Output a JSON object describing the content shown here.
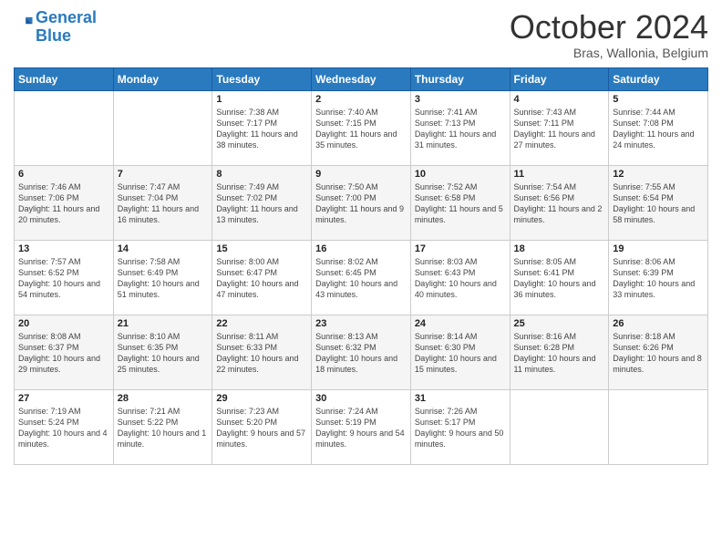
{
  "logo": {
    "line1": "General",
    "line2": "Blue"
  },
  "title": "October 2024",
  "subtitle": "Bras, Wallonia, Belgium",
  "days_of_week": [
    "Sunday",
    "Monday",
    "Tuesday",
    "Wednesday",
    "Thursday",
    "Friday",
    "Saturday"
  ],
  "weeks": [
    [
      {
        "day": "",
        "info": ""
      },
      {
        "day": "",
        "info": ""
      },
      {
        "day": "1",
        "info": "Sunrise: 7:38 AM\nSunset: 7:17 PM\nDaylight: 11 hours and 38 minutes."
      },
      {
        "day": "2",
        "info": "Sunrise: 7:40 AM\nSunset: 7:15 PM\nDaylight: 11 hours and 35 minutes."
      },
      {
        "day": "3",
        "info": "Sunrise: 7:41 AM\nSunset: 7:13 PM\nDaylight: 11 hours and 31 minutes."
      },
      {
        "day": "4",
        "info": "Sunrise: 7:43 AM\nSunset: 7:11 PM\nDaylight: 11 hours and 27 minutes."
      },
      {
        "day": "5",
        "info": "Sunrise: 7:44 AM\nSunset: 7:08 PM\nDaylight: 11 hours and 24 minutes."
      }
    ],
    [
      {
        "day": "6",
        "info": "Sunrise: 7:46 AM\nSunset: 7:06 PM\nDaylight: 11 hours and 20 minutes."
      },
      {
        "day": "7",
        "info": "Sunrise: 7:47 AM\nSunset: 7:04 PM\nDaylight: 11 hours and 16 minutes."
      },
      {
        "day": "8",
        "info": "Sunrise: 7:49 AM\nSunset: 7:02 PM\nDaylight: 11 hours and 13 minutes."
      },
      {
        "day": "9",
        "info": "Sunrise: 7:50 AM\nSunset: 7:00 PM\nDaylight: 11 hours and 9 minutes."
      },
      {
        "day": "10",
        "info": "Sunrise: 7:52 AM\nSunset: 6:58 PM\nDaylight: 11 hours and 5 minutes."
      },
      {
        "day": "11",
        "info": "Sunrise: 7:54 AM\nSunset: 6:56 PM\nDaylight: 11 hours and 2 minutes."
      },
      {
        "day": "12",
        "info": "Sunrise: 7:55 AM\nSunset: 6:54 PM\nDaylight: 10 hours and 58 minutes."
      }
    ],
    [
      {
        "day": "13",
        "info": "Sunrise: 7:57 AM\nSunset: 6:52 PM\nDaylight: 10 hours and 54 minutes."
      },
      {
        "day": "14",
        "info": "Sunrise: 7:58 AM\nSunset: 6:49 PM\nDaylight: 10 hours and 51 minutes."
      },
      {
        "day": "15",
        "info": "Sunrise: 8:00 AM\nSunset: 6:47 PM\nDaylight: 10 hours and 47 minutes."
      },
      {
        "day": "16",
        "info": "Sunrise: 8:02 AM\nSunset: 6:45 PM\nDaylight: 10 hours and 43 minutes."
      },
      {
        "day": "17",
        "info": "Sunrise: 8:03 AM\nSunset: 6:43 PM\nDaylight: 10 hours and 40 minutes."
      },
      {
        "day": "18",
        "info": "Sunrise: 8:05 AM\nSunset: 6:41 PM\nDaylight: 10 hours and 36 minutes."
      },
      {
        "day": "19",
        "info": "Sunrise: 8:06 AM\nSunset: 6:39 PM\nDaylight: 10 hours and 33 minutes."
      }
    ],
    [
      {
        "day": "20",
        "info": "Sunrise: 8:08 AM\nSunset: 6:37 PM\nDaylight: 10 hours and 29 minutes."
      },
      {
        "day": "21",
        "info": "Sunrise: 8:10 AM\nSunset: 6:35 PM\nDaylight: 10 hours and 25 minutes."
      },
      {
        "day": "22",
        "info": "Sunrise: 8:11 AM\nSunset: 6:33 PM\nDaylight: 10 hours and 22 minutes."
      },
      {
        "day": "23",
        "info": "Sunrise: 8:13 AM\nSunset: 6:32 PM\nDaylight: 10 hours and 18 minutes."
      },
      {
        "day": "24",
        "info": "Sunrise: 8:14 AM\nSunset: 6:30 PM\nDaylight: 10 hours and 15 minutes."
      },
      {
        "day": "25",
        "info": "Sunrise: 8:16 AM\nSunset: 6:28 PM\nDaylight: 10 hours and 11 minutes."
      },
      {
        "day": "26",
        "info": "Sunrise: 8:18 AM\nSunset: 6:26 PM\nDaylight: 10 hours and 8 minutes."
      }
    ],
    [
      {
        "day": "27",
        "info": "Sunrise: 7:19 AM\nSunset: 5:24 PM\nDaylight: 10 hours and 4 minutes."
      },
      {
        "day": "28",
        "info": "Sunrise: 7:21 AM\nSunset: 5:22 PM\nDaylight: 10 hours and 1 minute."
      },
      {
        "day": "29",
        "info": "Sunrise: 7:23 AM\nSunset: 5:20 PM\nDaylight: 9 hours and 57 minutes."
      },
      {
        "day": "30",
        "info": "Sunrise: 7:24 AM\nSunset: 5:19 PM\nDaylight: 9 hours and 54 minutes."
      },
      {
        "day": "31",
        "info": "Sunrise: 7:26 AM\nSunset: 5:17 PM\nDaylight: 9 hours and 50 minutes."
      },
      {
        "day": "",
        "info": ""
      },
      {
        "day": "",
        "info": ""
      }
    ]
  ]
}
